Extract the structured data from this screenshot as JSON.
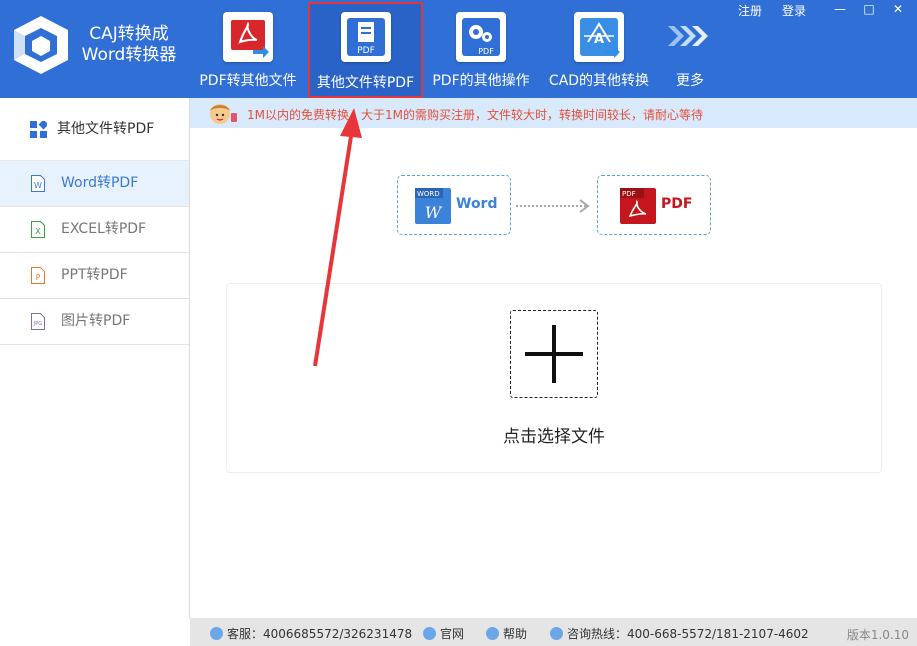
{
  "app": {
    "title_line1": "CAJ转换成",
    "title_line2": "Word转换器"
  },
  "nav": [
    {
      "label": "PDF转其他文件",
      "icon": "pdf-acrobat-icon"
    },
    {
      "label": "其他文件转PDF",
      "icon": "file-to-pdf-icon"
    },
    {
      "label": "PDF的其他操作",
      "icon": "pdf-settings-icon"
    },
    {
      "label": "CAD的其他转换",
      "icon": "cad-icon"
    },
    {
      "label": "更多",
      "icon": "more-arrows-icon"
    }
  ],
  "top_links": {
    "register": "注册",
    "login": "登录"
  },
  "window_controls": {
    "minimize": "—",
    "maximize": "□",
    "close": "✕"
  },
  "sidebar": {
    "header": "其他文件转PDF",
    "items": [
      {
        "label": "Word转PDF",
        "icon": "word-file-icon"
      },
      {
        "label": "EXCEL转PDF",
        "icon": "excel-file-icon"
      },
      {
        "label": "PPT转PDF",
        "icon": "ppt-file-icon"
      },
      {
        "label": "图片转PDF",
        "icon": "image-file-icon"
      }
    ]
  },
  "notice": "1M以内的免费转换，大于1M的需购买注册，文件较大时，转换时间较长，请耐心等待",
  "flow": {
    "source": {
      "badge": "WORD",
      "letter": "W",
      "label": "Word"
    },
    "target": {
      "badge": "PDF",
      "label": "PDF"
    }
  },
  "upload": {
    "label": "点击选择文件"
  },
  "status": {
    "service": "客服：4006685572/326231478",
    "website": "官网",
    "help": "帮助",
    "hotline": "咨询热线：400-668-5572/181-2107-4602",
    "version": "版本1.0.10"
  },
  "colors": {
    "topbar": "#2f6fd6",
    "accent": "#3a79d6",
    "highlight": "#e2363b",
    "notice_text": "#e55039"
  }
}
